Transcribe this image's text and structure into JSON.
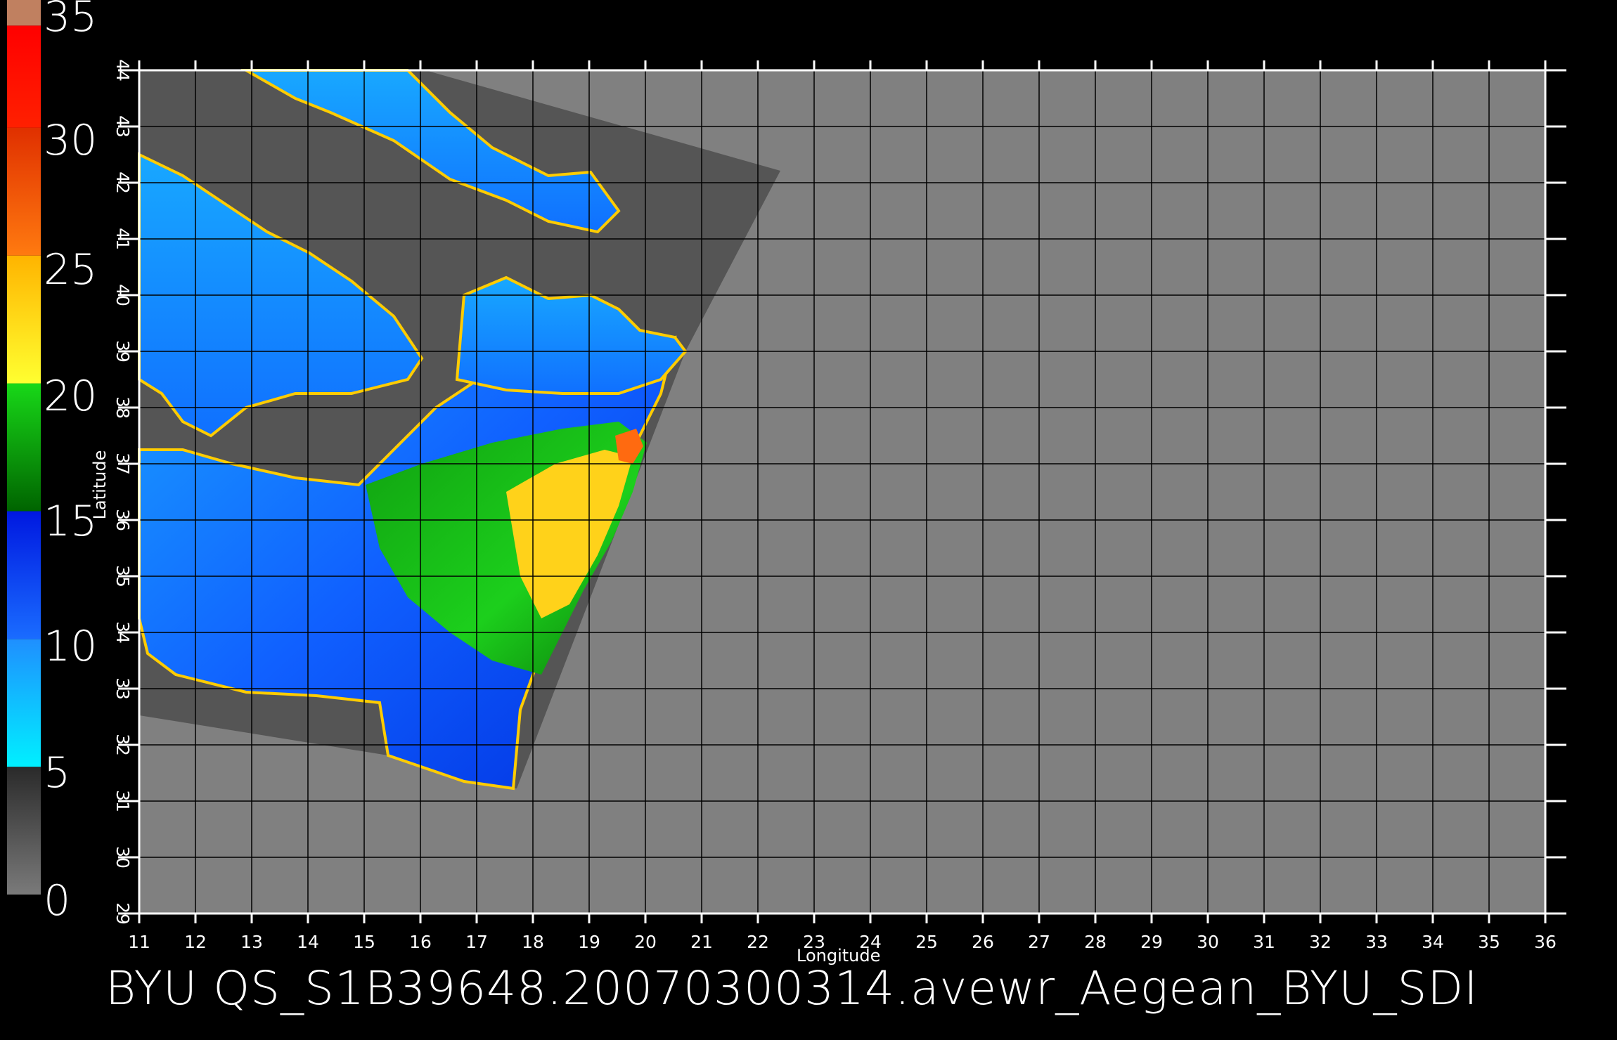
{
  "colorbar": {
    "labels": [
      "35",
      "30",
      "25",
      "20",
      "15",
      "10",
      "5",
      "0"
    ],
    "bands": [
      {
        "from": 0,
        "to": 5,
        "colors": [
          "#7a7a7a",
          "#2a2a2a"
        ]
      },
      {
        "from": 5,
        "to": 10,
        "colors": [
          "#00f0ff",
          "#1f8fff"
        ]
      },
      {
        "from": 10,
        "to": 15,
        "colors": [
          "#1a6cff",
          "#0018e0"
        ]
      },
      {
        "from": 15,
        "to": 20,
        "colors": [
          "#006400",
          "#18d818"
        ]
      },
      {
        "from": 20,
        "to": 25,
        "colors": [
          "#ffff30",
          "#ffb400"
        ]
      },
      {
        "from": 25,
        "to": 30,
        "colors": [
          "#ff7a10",
          "#e03000"
        ]
      },
      {
        "from": 30,
        "to": 34,
        "colors": [
          "#ff2000",
          "#ff0000"
        ]
      },
      {
        "from": 34,
        "to": 35,
        "colors": [
          "#c08060",
          "#c08060"
        ]
      }
    ],
    "max": 35
  },
  "map": {
    "x_axis": {
      "label": "Longitude",
      "ticks": [
        "11",
        "12",
        "13",
        "14",
        "15",
        "16",
        "17",
        "18",
        "19",
        "20",
        "21",
        "22",
        "23",
        "24",
        "25",
        "26",
        "27",
        "28",
        "29",
        "30",
        "31",
        "32",
        "33",
        "34",
        "35",
        "36"
      ],
      "range": [
        11,
        36
      ]
    },
    "y_axis": {
      "label": "Latitude",
      "ticks": [
        "29",
        "30",
        "31",
        "32",
        "33",
        "34",
        "35",
        "36",
        "37",
        "38",
        "39",
        "40",
        "41",
        "42",
        "43",
        "44"
      ],
      "range": [
        29,
        44
      ]
    },
    "colors": {
      "no_data": "#808080",
      "land": "#555555",
      "grid": "#000000",
      "frame": "#ffffff"
    }
  },
  "footer": {
    "title": "BYU  QS_S1B39648.20070300314.avewr_Aegean_BYU_SDI"
  }
}
